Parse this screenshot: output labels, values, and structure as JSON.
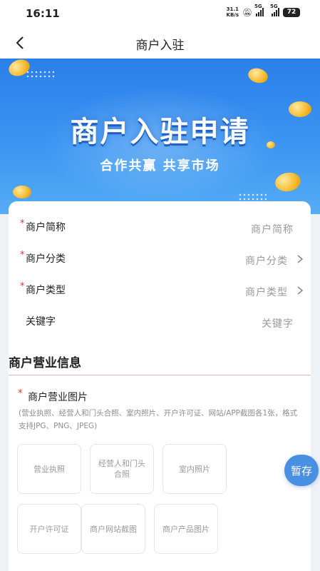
{
  "status_bar": {
    "time": "16:11",
    "net_speed_value": "31.1",
    "net_speed_unit": "KB/s",
    "sim1_tag": "5G",
    "sim2_tag": "5G",
    "battery": "72"
  },
  "nav": {
    "back_icon": "chevron-left-icon",
    "title": "商户入驻"
  },
  "banner": {
    "title": "商户入驻申请",
    "subtitle": "合作共赢  共享市场"
  },
  "form": {
    "fields": [
      {
        "label": "商户简称",
        "placeholder": "商户简称",
        "required": true,
        "has_arrow": false
      },
      {
        "label": "商户分类",
        "placeholder": "商户分类",
        "required": true,
        "has_arrow": true
      },
      {
        "label": "商户类型",
        "placeholder": "商户类型",
        "required": true,
        "has_arrow": true
      },
      {
        "label": "关键字",
        "placeholder": "关键字",
        "required": false,
        "has_arrow": false
      }
    ],
    "required_mark": "*"
  },
  "business_info": {
    "section_title": "商户营业信息",
    "pictures_label": "商户营业图片",
    "pictures_hint": "(营业执照、经营人和门头合照、室内照片、开户许可证、网站/APP截图各1张，格式支持JPG、PNG、JPEG)",
    "uploads": [
      "营业执照",
      "经营人和门头合照",
      "室内照片",
      "开户许可证",
      "商户网站截图",
      "商户产品图片"
    ]
  },
  "save_button": "暂存",
  "colors": {
    "accent": "#4a90e2",
    "required": "#e0352b",
    "banner_top": "#2b7fe9",
    "banner_bottom": "#56acf5"
  }
}
